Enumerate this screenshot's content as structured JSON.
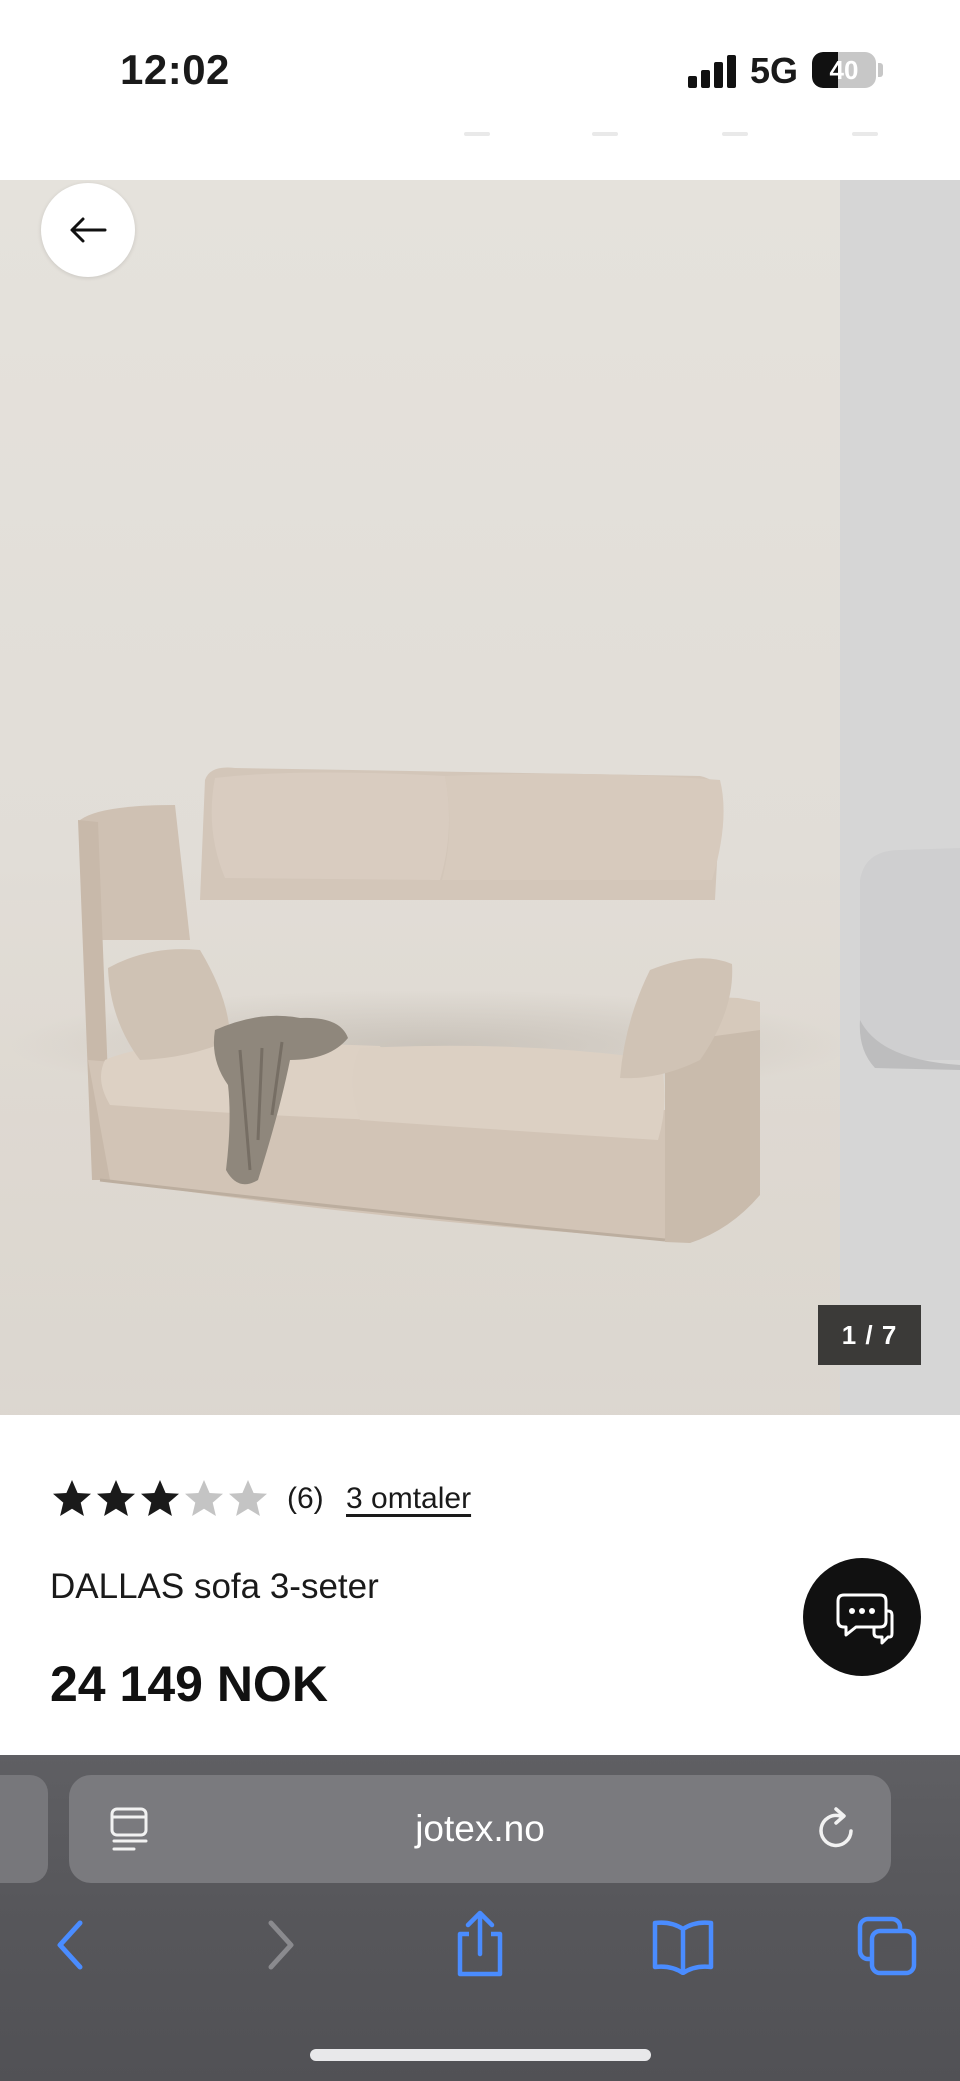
{
  "status_bar": {
    "time": "12:02",
    "network": "5G",
    "battery": "40",
    "battery_level_percent": 40
  },
  "gallery": {
    "counter": "1 / 7",
    "product_image": "beige linen 3-seater sofa with throw blanket",
    "back_icon": "arrow-left-icon"
  },
  "product": {
    "rating_stars": 3,
    "rating_max": 5,
    "rating_count": "(6)",
    "reviews_link": "3 omtaler",
    "name": "DALLAS sofa 3-seter",
    "price": "24 149 NOK"
  },
  "chat": {
    "icon": "chat-bubbles-icon"
  },
  "browser": {
    "url": "jotex.no",
    "left_icon": "reader-mode-icon",
    "right_icon": "reload-icon",
    "toolbar": [
      "back-icon",
      "forward-icon",
      "share-icon",
      "bookmarks-icon",
      "tabs-icon"
    ]
  },
  "colors": {
    "toolbar_icon": "#4a8cff",
    "toolbar_icon_disabled": "#8a8a8e",
    "star_filled": "#1a1a1a",
    "star_empty": "#c4c4c4"
  }
}
